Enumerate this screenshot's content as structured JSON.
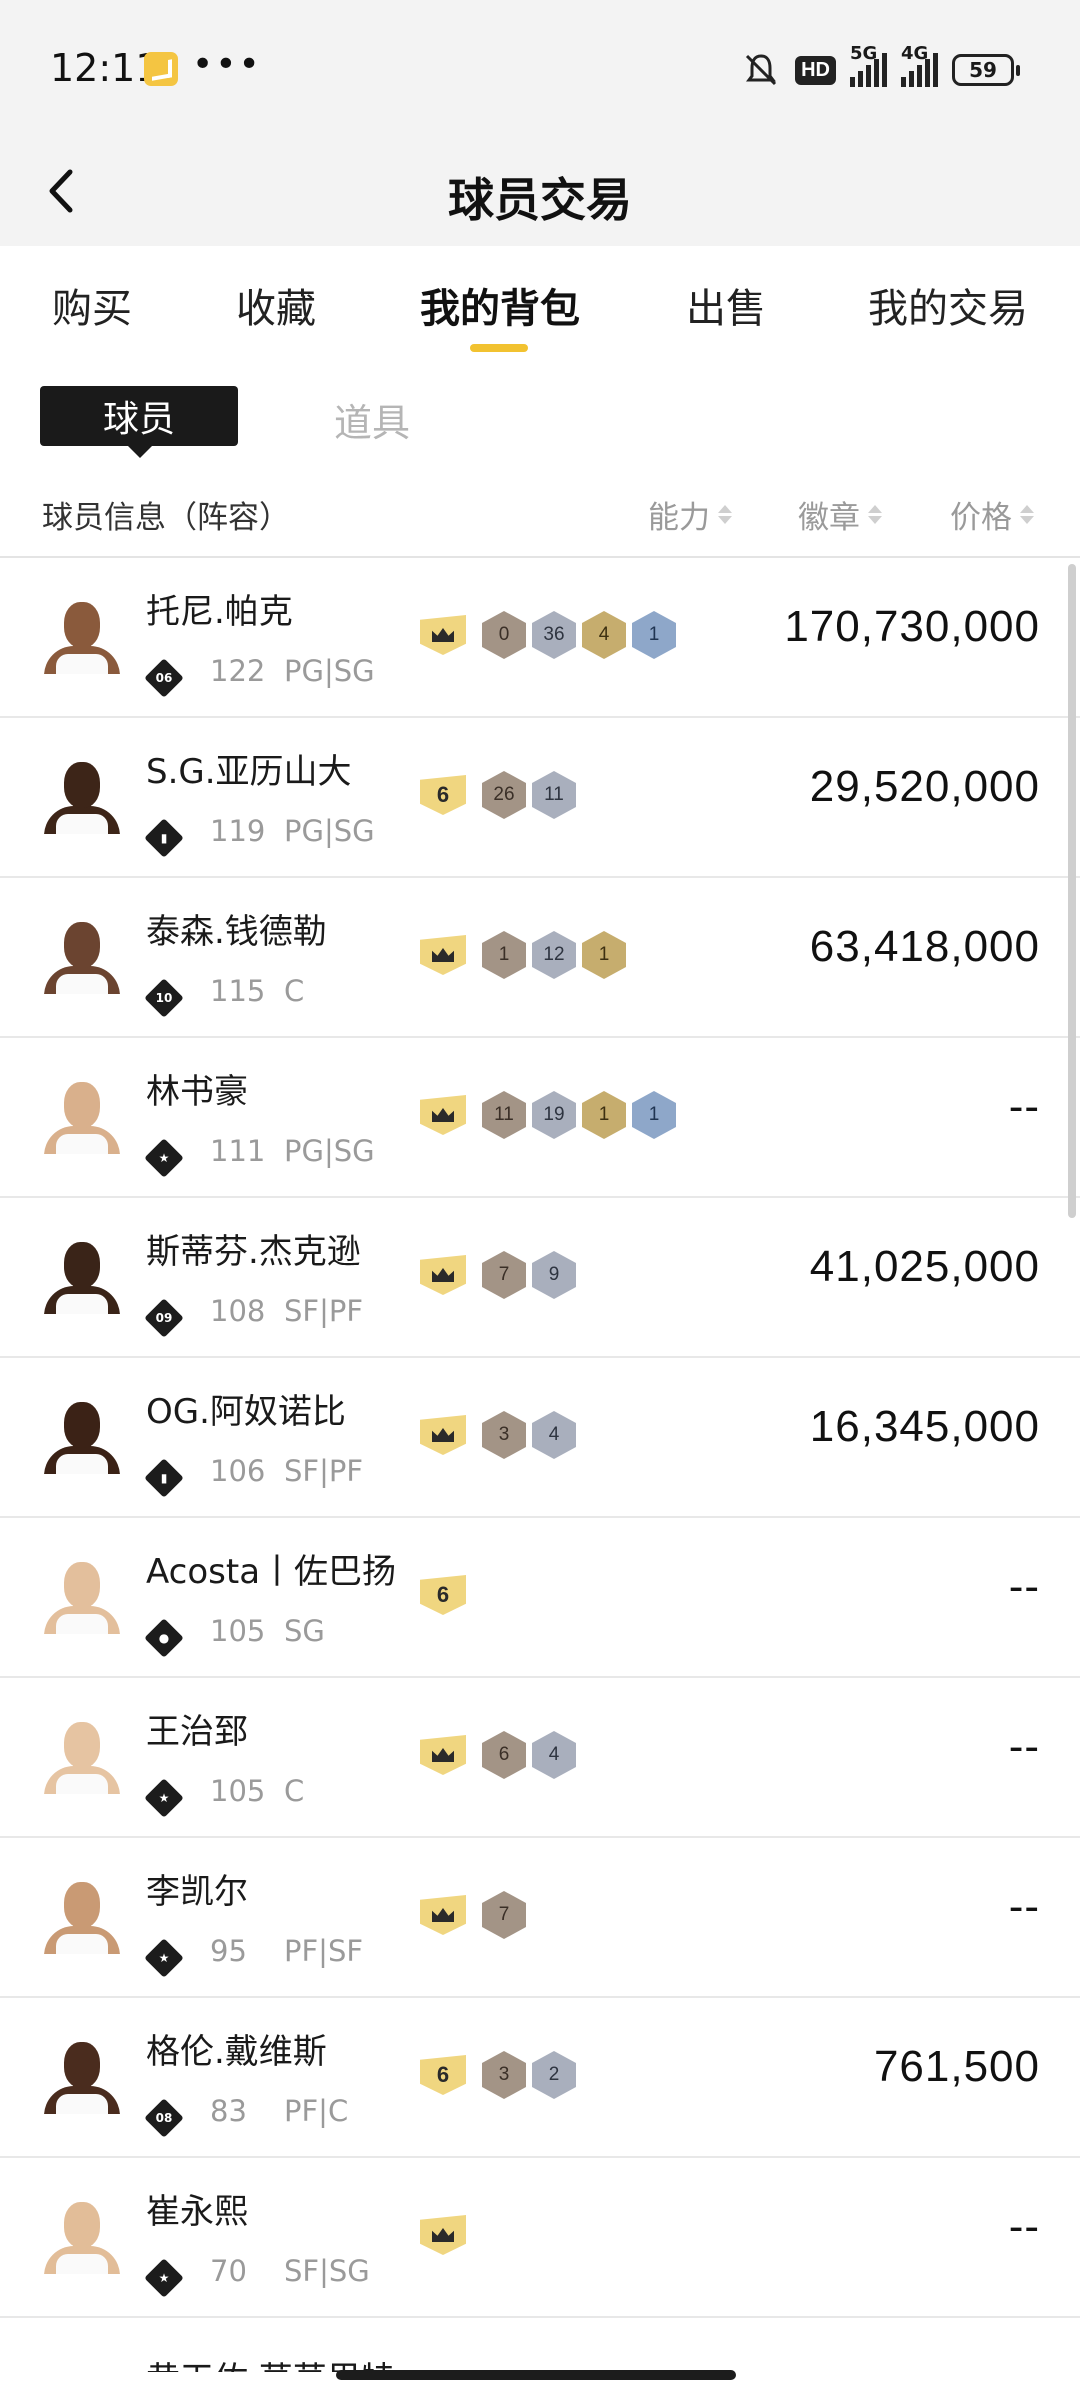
{
  "status_bar": {
    "time": "12:11",
    "dots": "•••",
    "hd": "HD",
    "net1": "5G",
    "net2": "4G",
    "battery": "59"
  },
  "header": {
    "title": "球员交易"
  },
  "tabs": [
    {
      "label": "购买",
      "active": false
    },
    {
      "label": "收藏",
      "active": false
    },
    {
      "label": "我的背包",
      "active": true
    },
    {
      "label": "出售",
      "active": false
    },
    {
      "label": "我的交易",
      "active": false
    }
  ],
  "subtabs": {
    "active": "球员",
    "other": "道具"
  },
  "columns": {
    "info": "球员信息（阵容）",
    "ability": "能力",
    "badges": "徽章",
    "price": "价格"
  },
  "players": [
    {
      "name": "托尼.帕克",
      "rank": "06",
      "ovr": "122",
      "pos": "PG|SG",
      "shield": "crown",
      "badges": [
        {
          "t": "bronze",
          "v": "0"
        },
        {
          "t": "silver",
          "v": "36"
        },
        {
          "t": "gold",
          "v": "4"
        },
        {
          "t": "blue",
          "v": "1"
        }
      ],
      "price": "170,730,000"
    },
    {
      "name": "S.G.亚历山大",
      "rank": "bars",
      "ovr": "119",
      "pos": "PG|SG",
      "shield": "6",
      "badges": [
        {
          "t": "bronze",
          "v": "26"
        },
        {
          "t": "silver",
          "v": "11"
        }
      ],
      "price": "29,520,000"
    },
    {
      "name": "泰森.钱德勒",
      "rank": "10",
      "ovr": "115",
      "pos": "C",
      "shield": "crown",
      "badges": [
        {
          "t": "bronze",
          "v": "1"
        },
        {
          "t": "silver",
          "v": "12"
        },
        {
          "t": "gold",
          "v": "1"
        }
      ],
      "price": "63,418,000"
    },
    {
      "name": "林书豪",
      "rank": "star",
      "ovr": "111",
      "pos": "PG|SG",
      "shield": "crown",
      "badges": [
        {
          "t": "bronze",
          "v": "11"
        },
        {
          "t": "silver",
          "v": "19"
        },
        {
          "t": "gold",
          "v": "1"
        },
        {
          "t": "blue",
          "v": "1"
        }
      ],
      "price": "--"
    },
    {
      "name": "斯蒂芬.杰克逊",
      "rank": "09",
      "ovr": "108",
      "pos": "SF|PF",
      "shield": "crown",
      "badges": [
        {
          "t": "bronze",
          "v": "7"
        },
        {
          "t": "silver",
          "v": "9"
        }
      ],
      "price": "41,025,000"
    },
    {
      "name": "OG.阿奴诺比",
      "rank": "bars",
      "ovr": "106",
      "pos": "SF|PF",
      "shield": "crown",
      "badges": [
        {
          "t": "bronze",
          "v": "3"
        },
        {
          "t": "silver",
          "v": "4"
        }
      ],
      "price": "16,345,000"
    },
    {
      "name": "Acosta丨佐巴扬",
      "rank": "person",
      "ovr": "105",
      "pos": "SG",
      "shield": "6",
      "badges": [],
      "price": "--"
    },
    {
      "name": "王治郅",
      "rank": "star",
      "ovr": "105",
      "pos": "C",
      "shield": "crown",
      "badges": [
        {
          "t": "bronze",
          "v": "6"
        },
        {
          "t": "silver",
          "v": "4"
        }
      ],
      "price": "--"
    },
    {
      "name": "李凯尔",
      "rank": "star",
      "ovr": "95",
      "pos": "PF|SF",
      "shield": "crown",
      "badges": [
        {
          "t": "bronze",
          "v": "7"
        }
      ],
      "price": "--"
    },
    {
      "name": "格伦.戴维斯",
      "rank": "08",
      "ovr": "83",
      "pos": "PF|C",
      "shield": "6",
      "badges": [
        {
          "t": "bronze",
          "v": "3"
        },
        {
          "t": "silver",
          "v": "2"
        }
      ],
      "price": "761,500"
    },
    {
      "name": "崔永熙",
      "rank": "star",
      "ovr": "70",
      "pos": "SF|SG",
      "shield": "crown",
      "badges": [],
      "price": "--"
    }
  ],
  "peek_name": "黄天佑.莫莫里特"
}
